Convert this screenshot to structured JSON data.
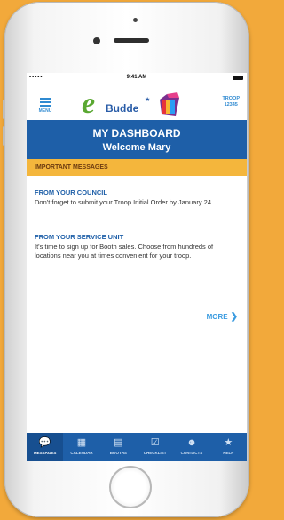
{
  "status_bar": {
    "signal": "•••••",
    "time": "9:41 AM"
  },
  "header": {
    "menu_label": "MENU",
    "logo_e": "e",
    "logo_word": "Budde",
    "troop_label": "TROOP",
    "troop_number": "12345"
  },
  "banner": {
    "title": "MY DASHBOARD",
    "welcome": "Welcome Mary"
  },
  "section_title": "IMPORTANT MESSAGES",
  "messages": [
    {
      "title": "FROM YOUR COUNCIL",
      "body": "Don't forget to submit your Troop Initial Order by January 24."
    },
    {
      "title": "FROM YOUR SERVICE UNIT",
      "body": "It's time to sign up for Booth sales. Choose from hundreds of locations near you at times convenient for your troop."
    }
  ],
  "more_label": "MORE",
  "tabs": [
    {
      "label": "MESSAGES",
      "icon": "chat-icon",
      "active": true
    },
    {
      "label": "CALENDAR",
      "icon": "calendar-icon",
      "active": false
    },
    {
      "label": "BOOTHS",
      "icon": "booth-icon",
      "active": false
    },
    {
      "label": "CHECKLIST",
      "icon": "checklist-icon",
      "active": false
    },
    {
      "label": "CONTACTS",
      "icon": "contacts-icon",
      "active": false
    },
    {
      "label": "HELP",
      "icon": "star-icon",
      "active": false
    }
  ],
  "colors": {
    "background": "#f2a93b",
    "brand_blue": "#1e5fa8",
    "accent_blue": "#2f8ad1",
    "section_yellow": "#f4b63c",
    "logo_green": "#5aa832"
  }
}
